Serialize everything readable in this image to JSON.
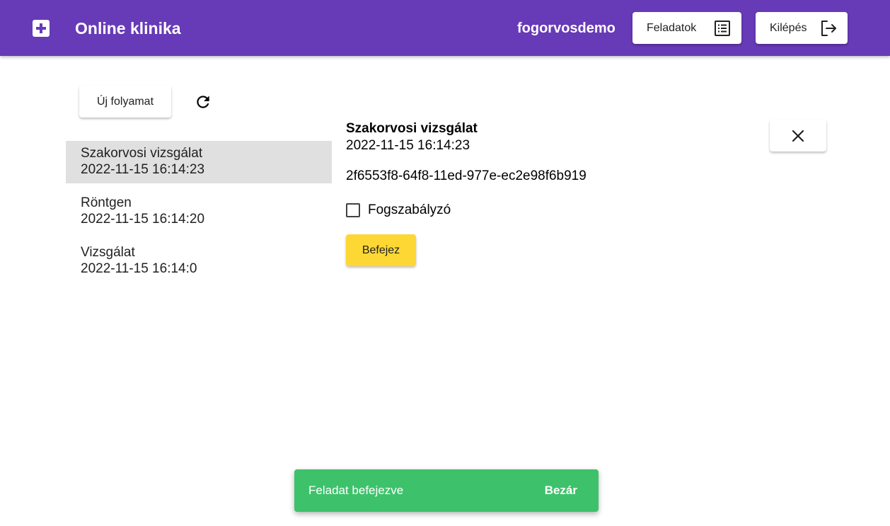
{
  "header": {
    "logo_icon": "medical-cross-icon",
    "title": "Online klinika",
    "username": "fogorvosdemo",
    "tasks_label": "Feladatok",
    "tasks_icon": "list-icon",
    "logout_label": "Kilépés",
    "logout_icon": "logout-icon",
    "accent_color": "#673ab7"
  },
  "toolbar": {
    "new_process_label": "Új folyamat",
    "refresh_icon": "refresh-icon"
  },
  "processes": [
    {
      "name": "Szakorvosi vizsgálat",
      "date": "2022-11-15 16:14:23"
    },
    {
      "name": "Röntgen",
      "date": "2022-11-15 16:14:20"
    },
    {
      "name": "Vizsgálat",
      "date": "2022-11-15 16:14:0"
    }
  ],
  "detail": {
    "title": "Szakorvosi vizsgálat",
    "date": "2022-11-15 16:14:23",
    "id": "2f6553f8-64f8-11ed-977e-ec2e98f6b919",
    "checkbox_label": "Fogszabályzó",
    "checkbox_checked": false,
    "finish_label": "Befejez",
    "finish_color": "#fdd835",
    "close_icon": "close-icon"
  },
  "snackbar": {
    "message": "Feladat befejezve",
    "action": "Bezár",
    "color": "#3dc26b"
  }
}
